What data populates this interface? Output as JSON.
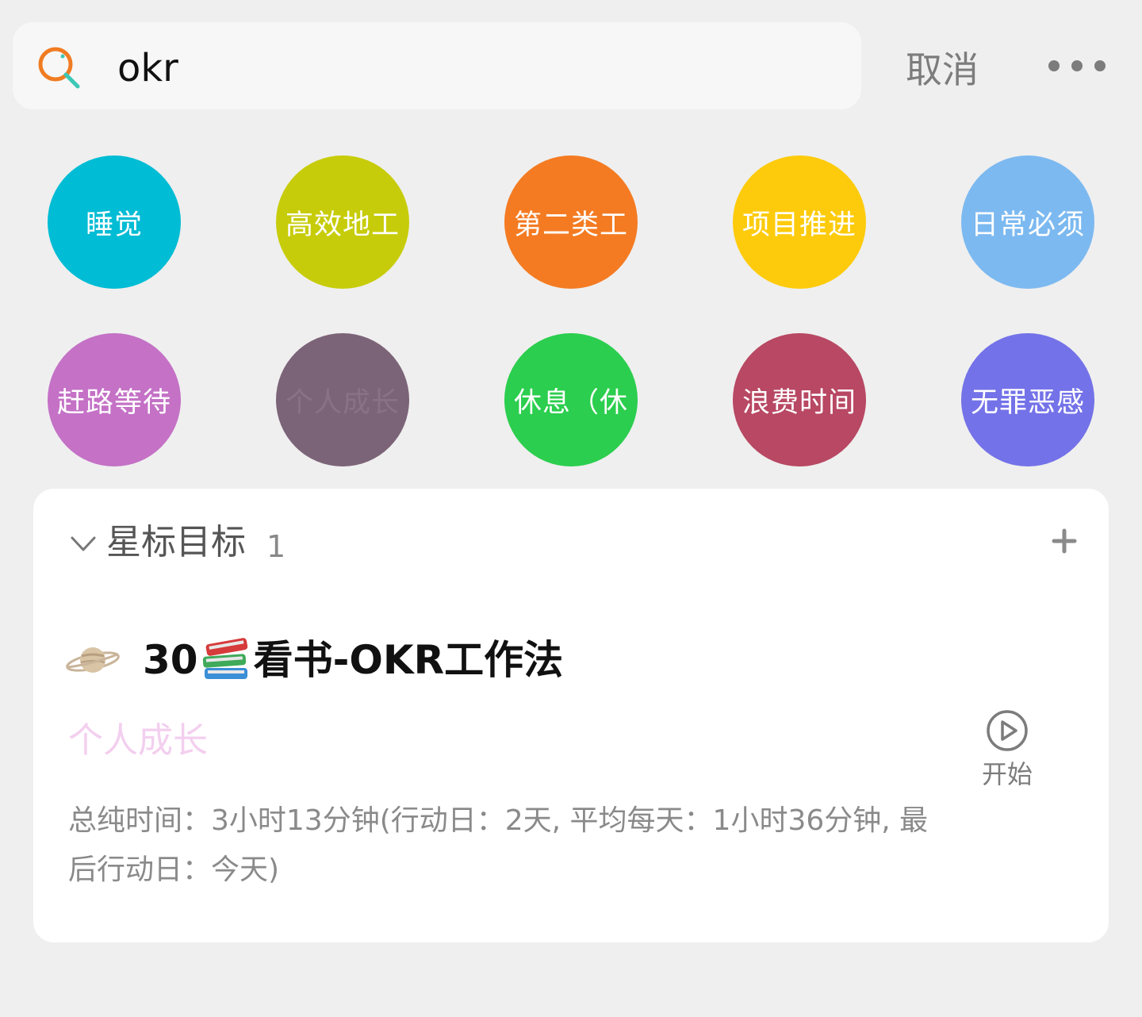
{
  "search": {
    "query": "okr",
    "cancel_label": "取消"
  },
  "tags": [
    {
      "label": "睡觉",
      "color": "#00bcd4",
      "text_color": "#ffffff"
    },
    {
      "label": "高效地工",
      "color": "#c7cc0a",
      "text_color": "#ffffff"
    },
    {
      "label": "第二类工",
      "color": "#f47b22",
      "text_color": "#ffffff"
    },
    {
      "label": "项目推进",
      "color": "#fdcb0c",
      "text_color": "#ffffff"
    },
    {
      "label": "日常必须",
      "color": "#7cb9f0",
      "text_color": "#ffffff"
    },
    {
      "label": "赶路等待",
      "color": "#c471c6",
      "text_color": "#ffffff"
    },
    {
      "label": "个人成长",
      "color": "#7c6478",
      "text_color": "#8a7286"
    },
    {
      "label": "休息（休",
      "color": "#2bce4e",
      "text_color": "#ffffff"
    },
    {
      "label": "浪费时间",
      "color": "#b84863",
      "text_color": "#ffffff"
    },
    {
      "label": "无罪恶感",
      "color": "#7472e8",
      "text_color": "#ffffff"
    }
  ],
  "section": {
    "title": "星标目标",
    "count": "1"
  },
  "goal": {
    "title_prefix": "30",
    "title_suffix": "看书-OKR工作法",
    "category": "个人成长",
    "stats": "总纯时间：3小时13分钟(行动日：2天, 平均每天：1小时36分钟, 最后行动日：今天)",
    "start_label": "开始",
    "icon": "planet-icon",
    "inline_icon": "books-icon"
  }
}
